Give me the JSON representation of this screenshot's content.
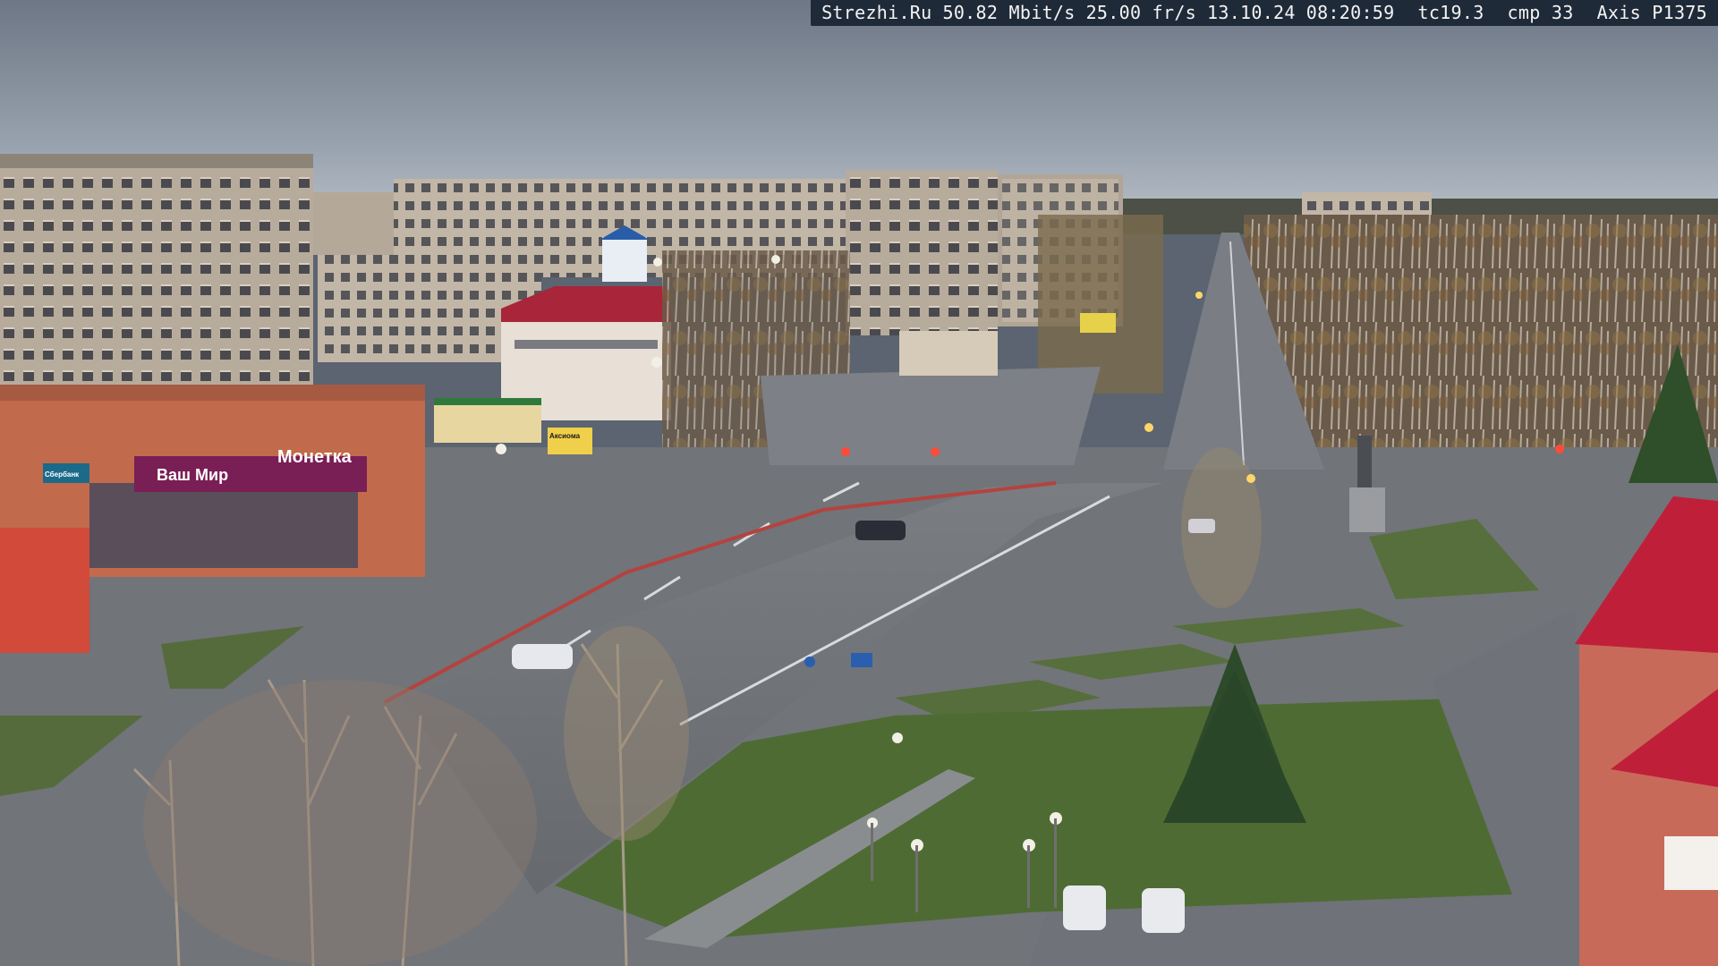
{
  "overlay": {
    "site": "Strezhi.Ru",
    "bitrate": "50.82 Mbit/s",
    "framerate": "25.00 fr/s",
    "date": "13.10.24",
    "time": "08:20:59",
    "tc": "tc19.3",
    "cmp": "cmp 33",
    "camera": "Axis P1375"
  },
  "signs": {
    "store_left": "Ваш Мир",
    "store_main": "Монеткa",
    "bank": "Сбербанк",
    "shop_small": "Аксиома"
  },
  "colors": {
    "sky_top": "#6f7986",
    "sky_bottom": "#aab3bd",
    "asphalt": "#6d7076",
    "grass": "#4f6a3a",
    "brick": "#c86a4a",
    "roof_red": "#c0223a",
    "osd_bg": "#1f2a38"
  }
}
